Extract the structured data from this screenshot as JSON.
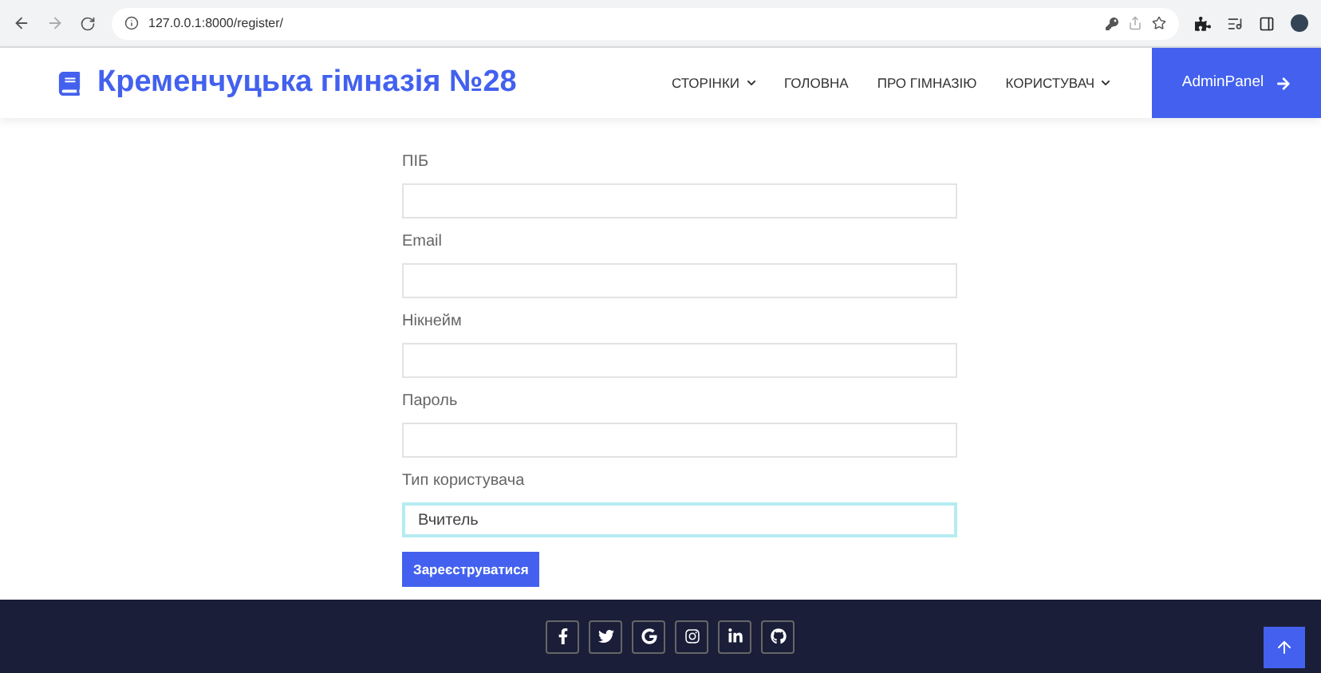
{
  "browser": {
    "url": "127.0.0.1:8000/register/"
  },
  "navbar": {
    "brand": "Кременчуцька гімназія №28",
    "items": [
      {
        "label": "СТОРІНКИ",
        "dropdown": true
      },
      {
        "label": "ГОЛОВНА",
        "dropdown": false
      },
      {
        "label": "ПРО ГІМНАЗІЮ",
        "dropdown": false
      },
      {
        "label": "КОРИСТУВАЧ",
        "dropdown": true
      }
    ],
    "cta": "AdminPanel"
  },
  "form": {
    "fields": [
      {
        "kind": "input",
        "label": "ПІБ",
        "focused": false
      },
      {
        "kind": "input",
        "label": "Email",
        "focused": false
      },
      {
        "kind": "input",
        "label": "Нікнейм",
        "focused": false
      },
      {
        "kind": "input",
        "label": "Пароль",
        "focused": false
      },
      {
        "kind": "select",
        "label": "Тип користувача",
        "value": "Вчитель",
        "focused": true
      }
    ],
    "submit": "Зареєструватися"
  }
}
